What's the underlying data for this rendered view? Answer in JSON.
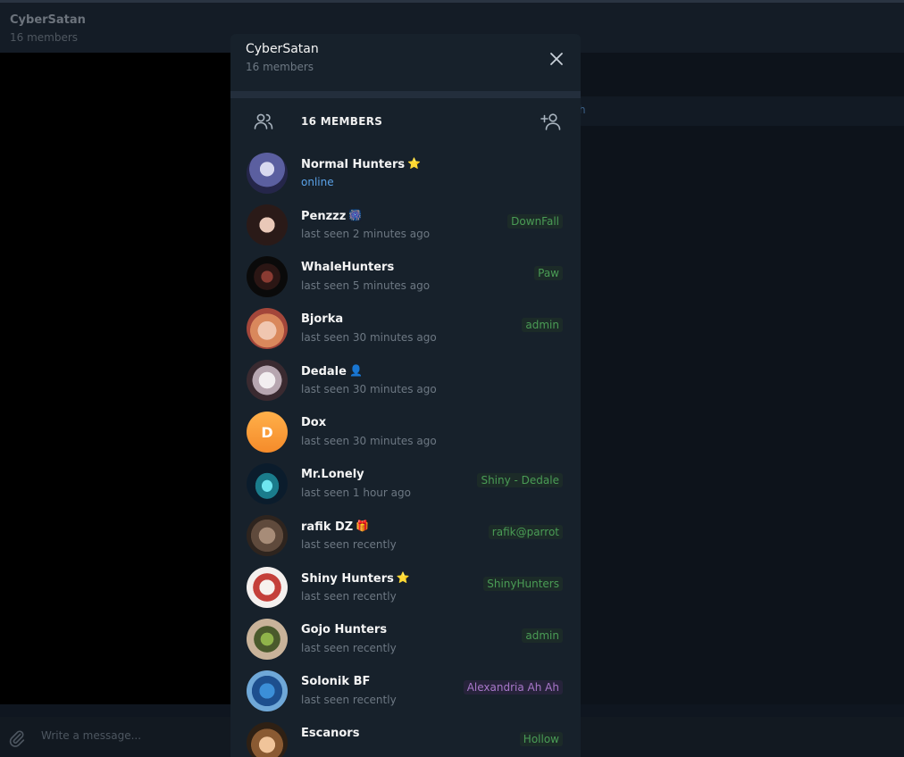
{
  "background": {
    "chat_title": "CyberSatan",
    "chat_subtitle": "16 members",
    "pinned_fragment": "h",
    "input_placeholder": "Write a message..."
  },
  "modal": {
    "title": "CyberSatan",
    "subtitle": "16 members",
    "members_count_label": "16 MEMBERS"
  },
  "colors": {
    "modal_bg": "#17212b",
    "online": "#5aa2e8",
    "tag_green": "#4a9c55",
    "tag_purple": "#a877c9",
    "muted": "#6d7883"
  },
  "members": [
    {
      "name": "Normal Hunters",
      "badge": "⭐",
      "status": "online",
      "tag": "",
      "avatar": "anime"
    },
    {
      "name": "Penzzz",
      "badge": "🎆",
      "status": "last seen 2 minutes ago",
      "tag": "DownFall",
      "avatar": "photo"
    },
    {
      "name": "WhaleHunters",
      "badge": "",
      "status": "last seen 5 minutes ago",
      "tag": "Paw",
      "avatar": "logo"
    },
    {
      "name": "Bjorka",
      "badge": "",
      "status": "last seen 30 minutes ago",
      "tag": "admin",
      "avatar": "photo"
    },
    {
      "name": "Dedale",
      "badge": "👤",
      "status": "last seen 30 minutes ago",
      "tag": "",
      "avatar": "anime"
    },
    {
      "name": "Dox",
      "badge": "",
      "status": "last seen 30 minutes ago",
      "tag": "",
      "avatar": "letter",
      "initial": "D"
    },
    {
      "name": "Mr.Lonely",
      "badge": "",
      "status": "last seen 1 hour ago",
      "tag": "Shiny - Dedale",
      "avatar": "ghost"
    },
    {
      "name": "rafik DZ",
      "badge": "🎁",
      "status": "last seen recently",
      "tag": "rafik@parrot",
      "avatar": "photo"
    },
    {
      "name": "Shiny Hunters",
      "badge": "⭐",
      "status": "last seen recently",
      "tag": "ShinyHunters",
      "avatar": "anime"
    },
    {
      "name": "Gojo Hunters",
      "badge": "",
      "status": "last seen recently",
      "tag": "admin",
      "avatar": "robot"
    },
    {
      "name": "Solonik BF",
      "badge": "",
      "status": "last seen recently",
      "tag": "Alexandria Ah Ah",
      "tag_style": "purple",
      "avatar": "anime"
    },
    {
      "name": "Escanors",
      "badge": "",
      "status": "",
      "tag": "Hollow",
      "avatar": "photo"
    }
  ]
}
